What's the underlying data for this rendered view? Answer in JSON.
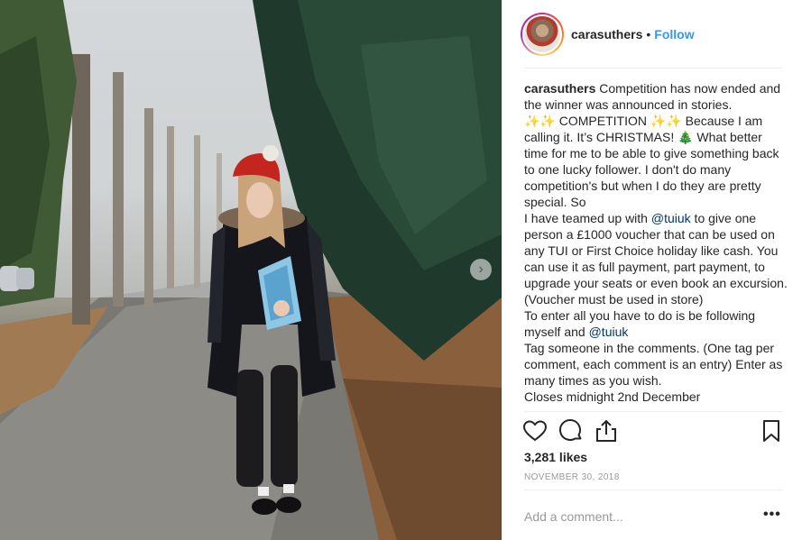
{
  "post": {
    "photo_alt": "woman in red beanie holding a book on a tree-lined path",
    "carousel_next_icon": "chevron-right-icon"
  },
  "header": {
    "username": "carasuthers",
    "separator": "•",
    "follow_label": "Follow"
  },
  "caption": {
    "username": "carasuthers",
    "line1": " Competition has now ended and the winner was announced in stories.",
    "line2": "✨✨ COMPETITION ✨✨ Because I am calling it. It’s CHRISTMAS! 🎄 What better time for me to be able to give something back to one lucky follower. I don't do many competition's but when I do they are pretty special. So",
    "line3a": "I have teamed up with ",
    "mention1": "@tuiuk",
    "line3b": " to give one person a £1000 voucher that can be used on any TUI or First Choice holiday like cash. You can use it as full payment, part payment, to upgrade your seats or even book an excursion. (Voucher must be used in store)",
    "line4": "To enter all you have to do is be following myself and ",
    "mention2": "@tuiuk",
    "line5": "Tag someone in the comments. (One tag per comment, each comment is an entry) Enter as many times as you wish.",
    "line6": "Closes midnight 2nd December"
  },
  "actions": {
    "like_icon": "heart-icon",
    "comment_icon": "comment-icon",
    "share_icon": "share-icon",
    "save_icon": "bookmark-icon"
  },
  "likes": {
    "count_text": "3,281 likes"
  },
  "date": "NOVEMBER 30, 2018",
  "comment": {
    "placeholder": "Add a comment...",
    "more_label": "•••"
  }
}
